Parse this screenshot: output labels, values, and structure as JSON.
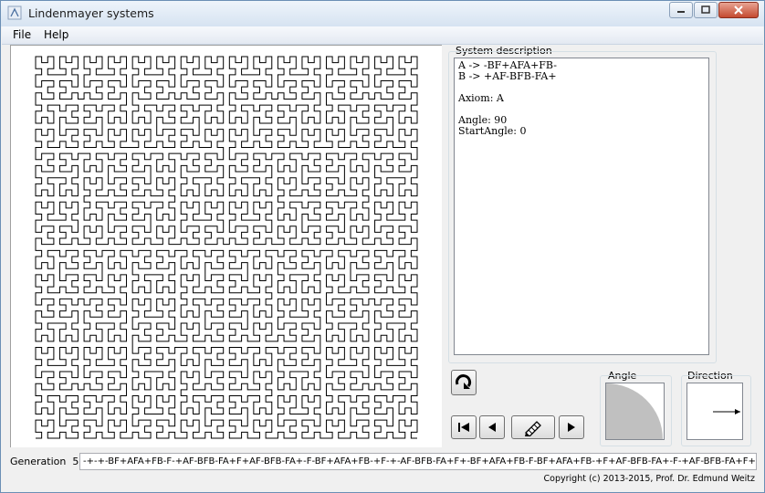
{
  "window": {
    "title": "Lindenmayer systems"
  },
  "menu": {
    "items": [
      "File",
      "Help"
    ]
  },
  "system_description": {
    "label": "System description",
    "lines": [
      "A -> -BF+AFA+FB-",
      "B -> +AF-BFB-FA+",
      "",
      "Axiom: A",
      "",
      "Angle: 90",
      "StartAngle: 0"
    ]
  },
  "angle_panel": {
    "label": "Angle",
    "value_deg": 90
  },
  "direction_panel": {
    "label": "Direction",
    "start_angle_deg": 0
  },
  "generation": {
    "label": "Generation",
    "number": "5:",
    "string": "-+-+-BF+AFA+FB-F-+AF-BFB-FA+F+AF-BFB-FA+-F-BF+AFA+FB-+F-+-AF-BFB-FA+F+-BF+AFA+FB-F-BF+AFA+FB-+F+AF-BFB-FA+-F-+AF-BFB-FA+F+-"
  },
  "footer": {
    "copyright": "Copyright (c) 2013-2015, Prof. Dr. Edmund Weitz"
  },
  "colors": {
    "curve": "#000000",
    "angle_fill": "#c0c0c0",
    "title_bg": "#dbe6f3"
  }
}
